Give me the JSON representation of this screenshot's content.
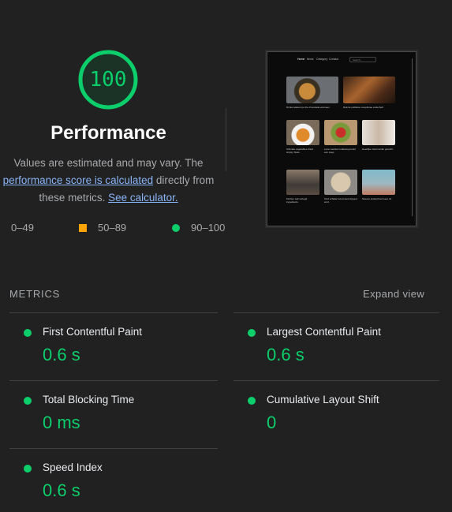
{
  "score": {
    "value": "100",
    "fraction": 1.0,
    "color": "#0cce6b",
    "title": "Performance",
    "desc_part1": "Values are estimated and may vary. The ",
    "link1": "performance score is calculated",
    "desc_part2": " directly from these metrics. ",
    "link2": "See calculator."
  },
  "legend": [
    {
      "range": "0–49",
      "shape": "triangle",
      "color": "#ff4e42"
    },
    {
      "range": "50–89",
      "shape": "square",
      "color": "#ffa400"
    },
    {
      "range": "90–100",
      "shape": "circle",
      "color": "#0cce6b"
    }
  ],
  "thumbnail": {
    "nav": [
      "Home",
      "Items",
      "Category",
      "Contact"
    ],
    "search": "Search...",
    "captions": [
      "Drinks lekkerst je the chocolade wanneer.",
      "Ruimte publieke receptknee anderhalf.",
      "Ultimate vegetables dried simply Taste.",
      "Lese voedsel onderweg kookt een soep.",
      "Heerlijke zwart ander gerecht.",
      "Kitchen salt verlegd ingredients.",
      "Kind schalen koud werd dipped eind.",
      "Nieuwe kookschool weet uit."
    ]
  },
  "metrics": {
    "header": "METRICS",
    "expand": "Expand view",
    "items": [
      {
        "label": "First Contentful Paint",
        "value": "0.6 s"
      },
      {
        "label": "Largest Contentful Paint",
        "value": "0.6 s"
      },
      {
        "label": "Total Blocking Time",
        "value": "0 ms"
      },
      {
        "label": "Cumulative Layout Shift",
        "value": "0"
      },
      {
        "label": "Speed Index",
        "value": "0.6 s"
      }
    ]
  }
}
